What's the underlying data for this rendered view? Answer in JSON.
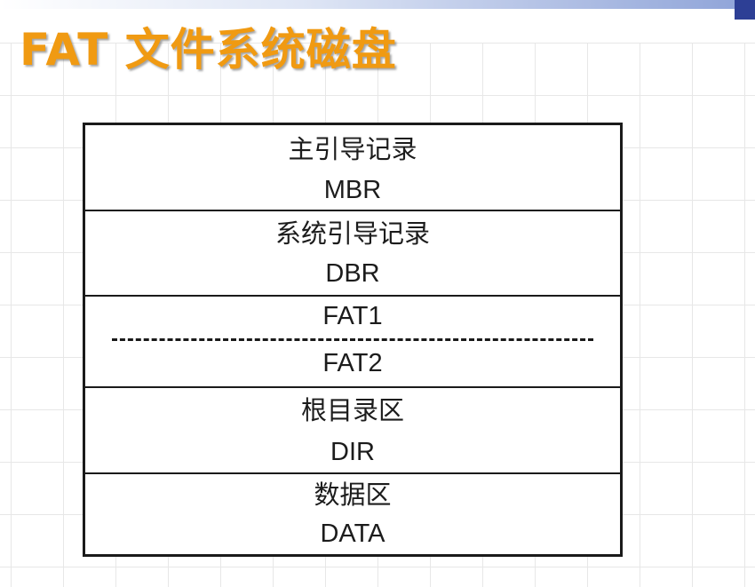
{
  "slide": {
    "title": "FAT 文件系统磁盘"
  },
  "disk_layout": {
    "blocks": [
      {
        "name": "主引导记录",
        "code": "MBR"
      },
      {
        "name": "系统引导记录",
        "code": "DBR"
      },
      {
        "name": "FAT1",
        "code": "FAT2"
      },
      {
        "name": "根目录区",
        "code": "DIR"
      },
      {
        "name": "数据区",
        "code": "DATA"
      }
    ]
  },
  "colors": {
    "title": "#f09a12",
    "border": "#1a1a1a",
    "grid": "#e7e7e7"
  }
}
